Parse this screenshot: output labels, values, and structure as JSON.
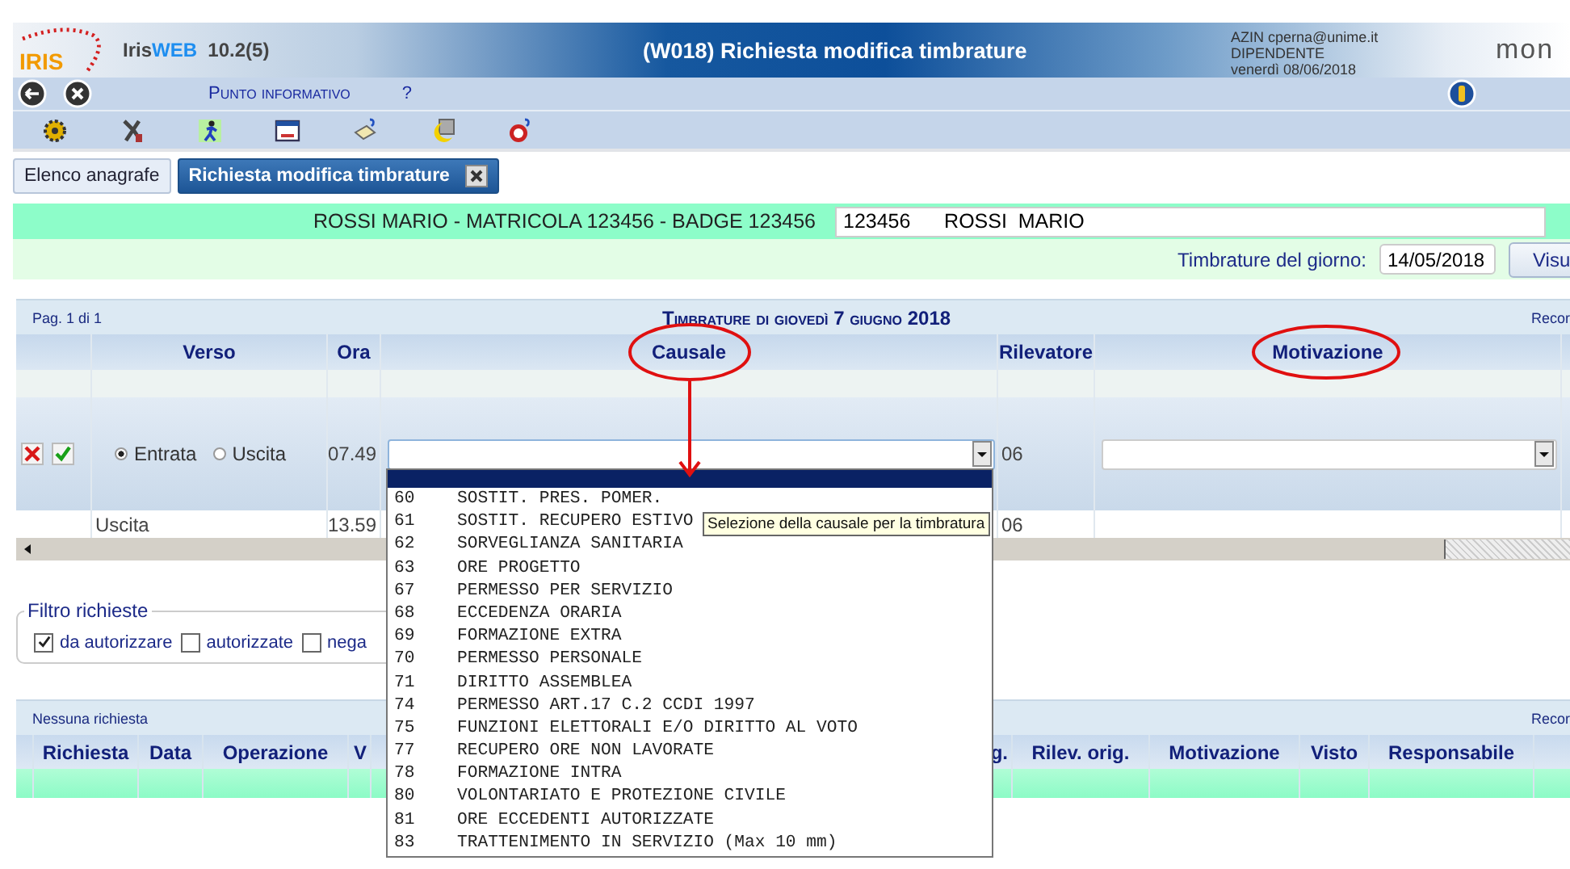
{
  "header": {
    "logo": "IRIS",
    "app_name_prefix": "Iris",
    "app_name_suffix": "WEB",
    "version": "10.2(5)",
    "title": "(W018) Richiesta modifica timbrature",
    "user_lines": [
      "AZIN cperna@unime.it",
      "DIPENDENTE",
      "venerdì 08/06/2018"
    ],
    "brand": "mon"
  },
  "menu": {
    "items": [
      "Punto informativo",
      "?"
    ]
  },
  "tabs": [
    {
      "label": "Elenco anagrafe",
      "selected": false,
      "closable": false
    },
    {
      "label": "Richiesta modifica timbrature",
      "selected": true,
      "closable": true
    }
  ],
  "employee": {
    "banner": "ROSSI MARIO - MATRICOLA 123456 - BADGE 123456",
    "field_value": "123456      ROSSI  MARIO"
  },
  "date_filter": {
    "label": "Timbrature del giorno:",
    "value": "14/05/2018",
    "button": "Visu"
  },
  "punches_table": {
    "pager": "Pag. 1 di 1",
    "title": "Timbrature di giovedì 7 giugno 2018",
    "records": "Recor",
    "columns": [
      "Verso",
      "Ora",
      "Causale",
      "Rilevatore",
      "Motivazione"
    ],
    "edit_row": {
      "direction_options": [
        {
          "label": "Entrata",
          "selected": true
        },
        {
          "label": "Uscita",
          "selected": false
        }
      ],
      "time": "07.49",
      "device": "06"
    },
    "rows": [
      {
        "verso": "Uscita",
        "ora": "13.59",
        "rilevatore": "06"
      }
    ]
  },
  "causale_dropdown": {
    "open": true,
    "options": [
      {
        "code": "60",
        "label": "SOSTIT. PRES. POMER."
      },
      {
        "code": "61",
        "label": "SOSTIT. RECUPERO ESTIVO"
      },
      {
        "code": "62",
        "label": "SORVEGLIANZA SANITARIA"
      },
      {
        "code": "63",
        "label": "ORE PROGETTO"
      },
      {
        "code": "67",
        "label": "PERMESSO PER SERVIZIO"
      },
      {
        "code": "68",
        "label": "ECCEDENZA ORARIA"
      },
      {
        "code": "69",
        "label": "FORMAZIONE EXTRA"
      },
      {
        "code": "70",
        "label": "PERMESSO PERSONALE"
      },
      {
        "code": "71",
        "label": "DIRITTO ASSEMBLEA"
      },
      {
        "code": "74",
        "label": "PERMESSO ART.17 C.2 CCDI 1997"
      },
      {
        "code": "75",
        "label": "FUNZIONI ELETTORALI E/O DIRITTO AL VOTO"
      },
      {
        "code": "77",
        "label": "RECUPERO ORE NON LAVORATE"
      },
      {
        "code": "78",
        "label": "FORMAZIONE INTRA"
      },
      {
        "code": "80",
        "label": "VOLONTARIATO E PROTEZIONE CIVILE"
      },
      {
        "code": "81",
        "label": "ORE ECCEDENTI AUTORIZZATE"
      },
      {
        "code": "83",
        "label": "TRATTENIMENTO IN SERVIZIO (Max 10 mm)"
      }
    ]
  },
  "tooltip": "Selezione della causale per la timbratura",
  "filter": {
    "legend": "Filtro richieste",
    "options": [
      {
        "label": "da autorizzare",
        "checked": true
      },
      {
        "label": "autorizzate",
        "checked": false
      },
      {
        "label": "nega",
        "checked": false
      }
    ]
  },
  "requests_table": {
    "status": "Nessuna richiesta",
    "records": "Recor",
    "columns": [
      "Richiesta",
      "Data",
      "Operazione",
      "V",
      "g.",
      "Rilev. orig.",
      "Motivazione",
      "Visto",
      "Responsabile"
    ]
  }
}
